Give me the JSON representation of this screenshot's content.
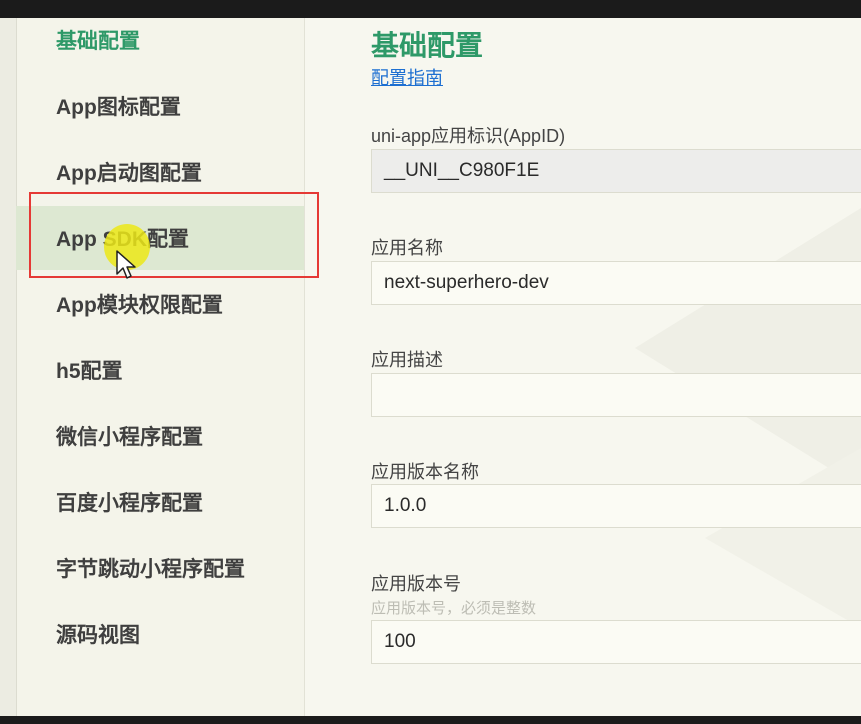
{
  "sidebar": {
    "items": [
      {
        "label": "基础配置"
      },
      {
        "label": "App图标配置"
      },
      {
        "label": "App启动图配置"
      },
      {
        "label": "App SDK配置"
      },
      {
        "label": "App模块权限配置"
      },
      {
        "label": "h5配置"
      },
      {
        "label": "微信小程序配置"
      },
      {
        "label": "百度小程序配置"
      },
      {
        "label": "字节跳动小程序配置"
      },
      {
        "label": "源码视图"
      }
    ],
    "active_index": 0,
    "selected_index": 3
  },
  "main": {
    "title": "基础配置",
    "guide_link": "配置指南",
    "fields": [
      {
        "label": "uni-app应用标识(AppID)",
        "value": "__UNI__C980F1E",
        "readonly": true
      },
      {
        "label": "应用名称",
        "value": "next-superhero-dev"
      },
      {
        "label": "应用描述",
        "value": ""
      },
      {
        "label": "应用版本名称",
        "value": "1.0.0"
      },
      {
        "label": "应用版本号",
        "hint": "应用版本号，必须是整数",
        "value": "100"
      }
    ]
  },
  "colors": {
    "accent": "#2e9968",
    "link": "#1d6fd1",
    "annotation_box": "#e53935",
    "cursor_highlight": "#ece818",
    "selected_row": "#dde8d2"
  }
}
